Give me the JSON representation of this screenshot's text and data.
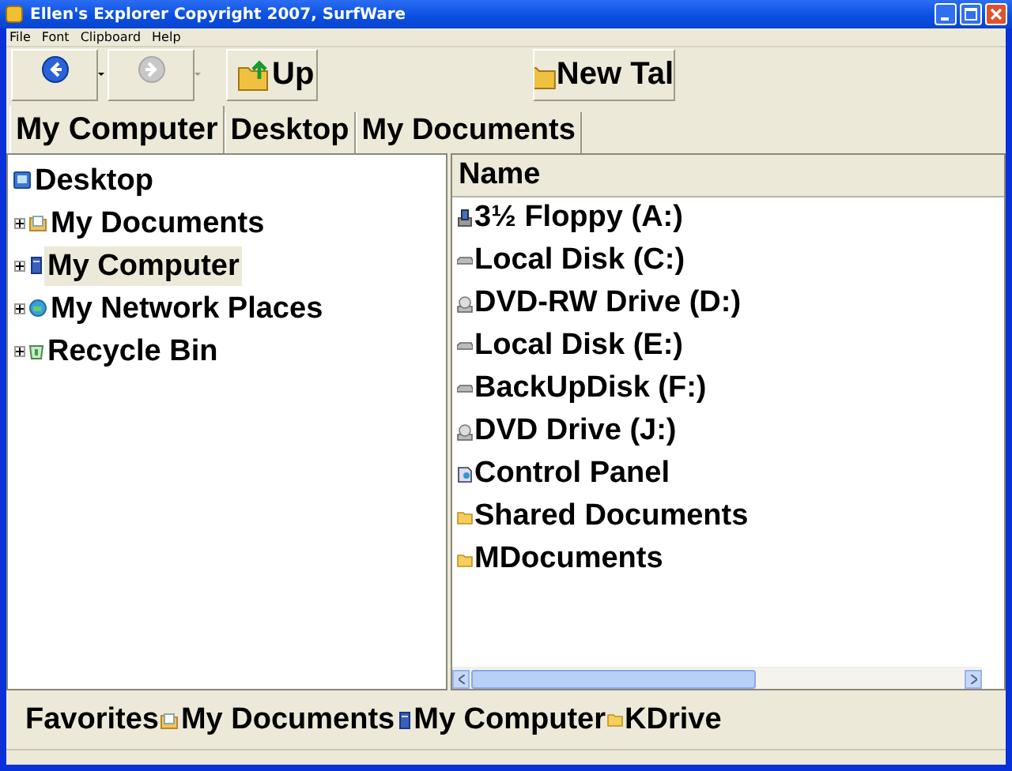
{
  "window": {
    "title": "Ellen's Explorer Copyright 2007, SurfWare"
  },
  "menu": [
    "File",
    "Font",
    "Clipboard",
    "Help"
  ],
  "toolbar": [
    {
      "kind": "back",
      "disabled": false
    },
    {
      "kind": "forward",
      "disabled": true
    },
    {
      "kind": "up",
      "label": "Up"
    },
    {
      "kind": "new-tab",
      "label": "New Tal"
    }
  ],
  "tabs": [
    {
      "label": "My Computer",
      "selected": true
    },
    {
      "label": "Desktop",
      "selected": false
    },
    {
      "label": "My Documents",
      "selected": false
    }
  ],
  "tree": {
    "label": "Desktop",
    "kind": "desktop",
    "selected": false,
    "children": [
      {
        "label": "My Documents",
        "kind": "documents",
        "selected": false,
        "expanded": false
      },
      {
        "label": "My Computer",
        "kind": "computer",
        "selected": true,
        "expanded": false
      },
      {
        "label": "My Network Places",
        "kind": "network",
        "selected": false,
        "expanded": false
      },
      {
        "label": "Recycle Bin",
        "kind": "recycle",
        "selected": false,
        "expanded": false
      }
    ]
  },
  "list": {
    "columns": [
      "Name"
    ],
    "items": [
      {
        "name": "3½ Floppy (A:)",
        "kind": "floppy"
      },
      {
        "name": "Local Disk (C:)",
        "kind": "disk"
      },
      {
        "name": "DVD-RW Drive (D:)",
        "kind": "cdrom"
      },
      {
        "name": "Local Disk (E:)",
        "kind": "disk"
      },
      {
        "name": "BackUpDisk (F:)",
        "kind": "disk"
      },
      {
        "name": "DVD Drive (J:)",
        "kind": "cdrom"
      },
      {
        "name": "Control Panel",
        "kind": "control"
      },
      {
        "name": "Shared Documents",
        "kind": "folder"
      },
      {
        "name": "MDocuments",
        "kind": "folder"
      }
    ]
  },
  "favorites": {
    "label": "Favorites",
    "items": [
      {
        "label": "My Documents",
        "kind": "documents"
      },
      {
        "label": "My Computer",
        "kind": "computer"
      },
      {
        "label": "KDrive",
        "kind": "folder"
      }
    ]
  }
}
